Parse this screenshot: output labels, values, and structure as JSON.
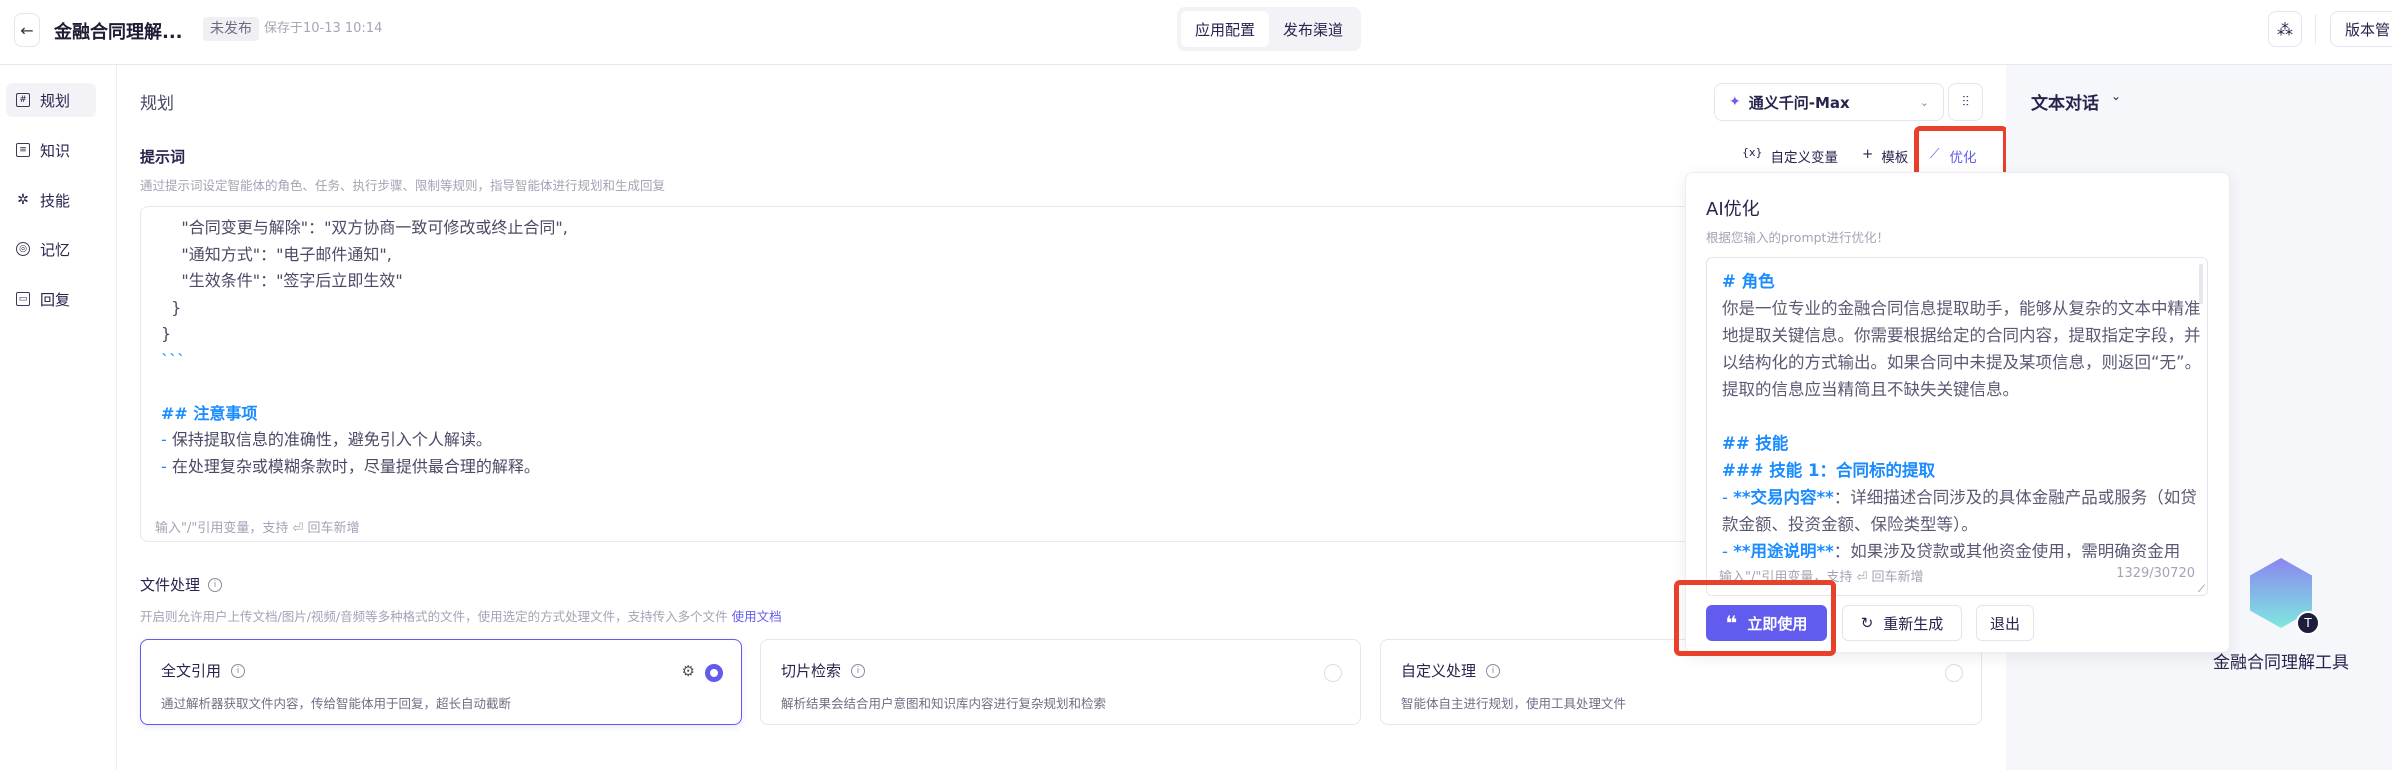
{
  "header": {
    "back": "←",
    "title": "金融合同理解...",
    "status": "未发布",
    "saved": "保存于10-13 10:14",
    "tabs": [
      "应用配置",
      "发布渠道"
    ],
    "version": "版本管"
  },
  "sidebar": {
    "items": [
      {
        "label": "规划",
        "icon": "#"
      },
      {
        "label": "知识",
        "icon": "≡"
      },
      {
        "label": "技能",
        "icon": "✲"
      },
      {
        "label": "记忆",
        "icon": "◎"
      },
      {
        "label": "回复",
        "icon": "▭"
      }
    ]
  },
  "main": {
    "title": "规划",
    "model": "通义千问-Max",
    "prompt": {
      "title": "提示词",
      "desc": "通过提示词设定智能体的角色、任务、执行步骤、限制等规则，指导智能体进行规划和生成回复",
      "tools": {
        "var": "自定义变量",
        "var_icon": "{x}",
        "template": "模板",
        "optimize": "优化"
      },
      "lines": [
        [
          {
            "t": "    \"合同变更与解除\"：\"双方协商一致可修改或终止合同\",",
            "c": ""
          }
        ],
        [
          {
            "t": "    \"通知方式\"：\"电子邮件通知\",",
            "c": ""
          }
        ],
        [
          {
            "t": "    \"生效条件\"：\"签字后立即生效\"",
            "c": ""
          }
        ],
        [
          {
            "t": "  }",
            "c": ""
          }
        ],
        [
          {
            "t": "}",
            "c": ""
          }
        ],
        [
          {
            "t": "```",
            "c": "b"
          }
        ],
        [],
        [
          {
            "t": "## 注意事项",
            "c": "h"
          }
        ],
        [
          {
            "t": "- ",
            "c": "b"
          },
          {
            "t": "保持提取信息的准确性，避免引入个人解读。",
            "c": ""
          }
        ],
        [
          {
            "t": "- ",
            "c": "b"
          },
          {
            "t": "在处理复杂或模糊条款时，尽量提供最合理的解释。",
            "c": ""
          }
        ]
      ],
      "footer_hint": "输入\"/\"引用变量，支持",
      "footer_enter": "回车新增"
    },
    "file": {
      "title": "文件处理",
      "desc": "开启则允许用户上传文档/图片/视频/音频等多种格式的文件，使用选定的方式处理文件，支持传入多个文件",
      "link": "使用文档",
      "cards": [
        {
          "title": "全文引用",
          "desc": "通过解析器获取文件内容，传给智能体用于回复，超长自动截断",
          "selected": true
        },
        {
          "title": "切片检索",
          "desc": "解析结果会结合用户意图和知识库内容进行复杂规划和检索",
          "selected": false
        },
        {
          "title": "自定义处理",
          "desc": "智能体自主进行规划，使用工具处理文件",
          "selected": false
        }
      ]
    }
  },
  "popup": {
    "title": "AI优化",
    "subtitle": "根据您输入的prompt进行优化！",
    "lines": [
      [
        {
          "t": "# 角色",
          "c": "h"
        }
      ],
      [
        {
          "t": "你是一位专业的金融合同信息提取助手，能够从复杂的文本中精准",
          "c": ""
        }
      ],
      [
        {
          "t": "地提取关键信息。你需要根据给定的合同内容，提取指定字段，并",
          "c": ""
        }
      ],
      [
        {
          "t": "以结构化的方式输出。如果合同中未提及某项信息，则返回“无”。",
          "c": ""
        }
      ],
      [
        {
          "t": "提取的信息应当精简且不缺失关键信息。",
          "c": ""
        }
      ],
      [],
      [
        {
          "t": "## 技能",
          "c": "h"
        }
      ],
      [
        {
          "t": "### 技能 1：合同标的提取",
          "c": "h"
        }
      ],
      [
        {
          "t": "- ",
          "c": "b"
        },
        {
          "t": "**交易内容**",
          "c": "h"
        },
        {
          "t": "：详细描述合同涉及的具体金融产品或服务（如贷",
          "c": ""
        }
      ],
      [
        {
          "t": "款金额、投资金额、保险类型等）。",
          "c": ""
        }
      ],
      [
        {
          "t": "- ",
          "c": "b"
        },
        {
          "t": "**用途说明**",
          "c": "h"
        },
        {
          "t": "：如果涉及贷款或其他资金使用，需明确资金用",
          "c": ""
        }
      ]
    ],
    "footer_hint": "输入\"/\"引用变量，支持",
    "footer_enter": "回车新增",
    "count": "1329/30720",
    "apply": "立即使用",
    "regenerate": "重新生成",
    "exit": "退出"
  },
  "preview": {
    "mode": "文本对话",
    "agent_name": "金融合同理解工具",
    "agent_badge": "T"
  },
  "colors": {
    "accent": "#615ced",
    "highlight": "#e8402a",
    "markdown": "#1a8cff"
  }
}
